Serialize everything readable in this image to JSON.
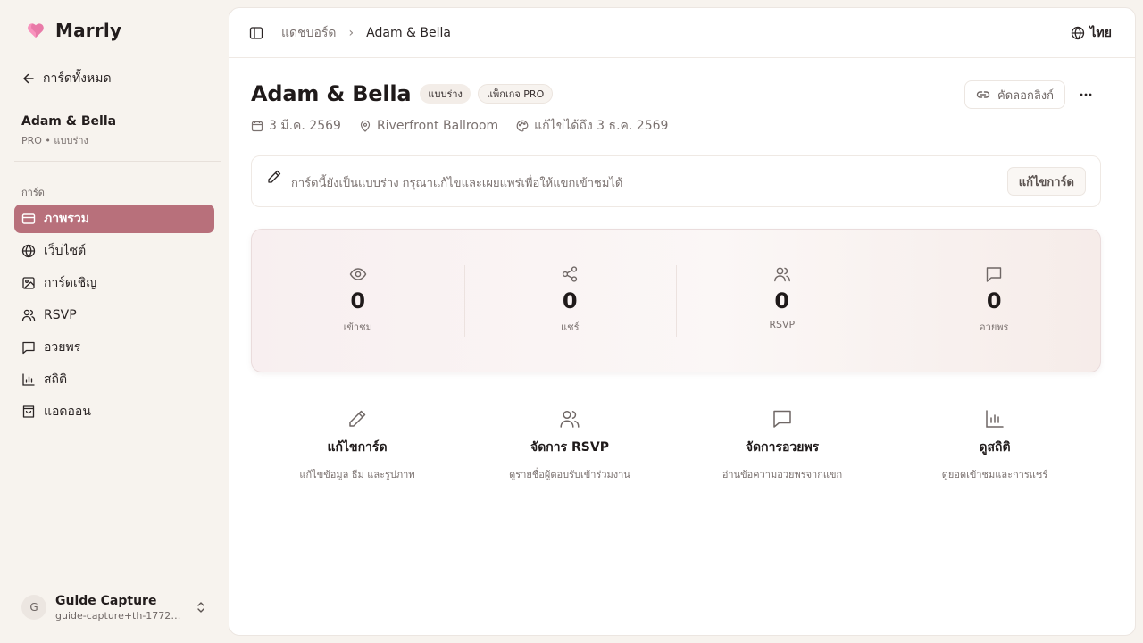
{
  "brand": {
    "name": "Marrly",
    "accent": "#b8707b",
    "logo_icon": "heart-icon"
  },
  "sidebar": {
    "back_label": "การ์ดทั้งหมด",
    "card_name": "Adam & Bella",
    "card_meta": "PRO • แบบร่าง",
    "section_label": "การ์ด",
    "items": [
      {
        "label": "ภาพรวม",
        "icon": "card-icon",
        "active": true
      },
      {
        "label": "เว็บไซต์",
        "icon": "globe-icon",
        "active": false
      },
      {
        "label": "การ์ดเชิญ",
        "icon": "image-icon",
        "active": false
      },
      {
        "label": "RSVP",
        "icon": "users-icon",
        "active": false
      },
      {
        "label": "อวยพร",
        "icon": "message-icon",
        "active": false
      },
      {
        "label": "สถิติ",
        "icon": "bar-chart-icon",
        "active": false
      },
      {
        "label": "แอดออน",
        "icon": "shopping-bag-icon",
        "active": false
      }
    ],
    "user": {
      "initial": "G",
      "name": "Guide Capture",
      "email": "guide-capture+th-17725..."
    }
  },
  "topbar": {
    "breadcrumb": [
      "แดชบอร์ด",
      "Adam & Bella"
    ],
    "separator": "›",
    "language": "ไทย"
  },
  "header": {
    "title": "Adam & Bella",
    "badges": [
      "แบบร่าง",
      "แพ็กเกจ PRO"
    ],
    "copy_link_label": "คัดลอกลิงก์",
    "more_label": "···",
    "meta": {
      "date": "3 มี.ค. 2569",
      "venue": "Riverfront Ballroom",
      "editable_until": "แก้ไขได้ถึง 3 ธ.ค. 2569"
    }
  },
  "notice": {
    "text": "การ์ดนี้ยังเป็นแบบร่าง กรุณาแก้ไขและเผยแพร่เพื่อให้แขกเข้าชมได้",
    "button": "แก้ไขการ์ด"
  },
  "stats": [
    {
      "icon": "eye-icon",
      "value": "0",
      "label": "เข้าชม"
    },
    {
      "icon": "share-icon",
      "value": "0",
      "label": "แชร์"
    },
    {
      "icon": "users-icon",
      "value": "0",
      "label": "RSVP"
    },
    {
      "icon": "message-icon",
      "value": "0",
      "label": "อวยพร"
    }
  ],
  "actions": [
    {
      "icon": "pencil-icon",
      "title": "แก้ไขการ์ด",
      "desc": "แก้ไขข้อมูล ธีม และรูปภาพ"
    },
    {
      "icon": "users-icon",
      "title": "จัดการ RSVP",
      "desc": "ดูรายชื่อผู้ตอบรับเข้าร่วมงาน"
    },
    {
      "icon": "message-icon",
      "title": "จัดการอวยพร",
      "desc": "อ่านข้อความอวยพรจากแขก"
    },
    {
      "icon": "bar-chart-icon",
      "title": "ดูสถิติ",
      "desc": "ดูยอดเข้าชมและการแชร์"
    }
  ]
}
